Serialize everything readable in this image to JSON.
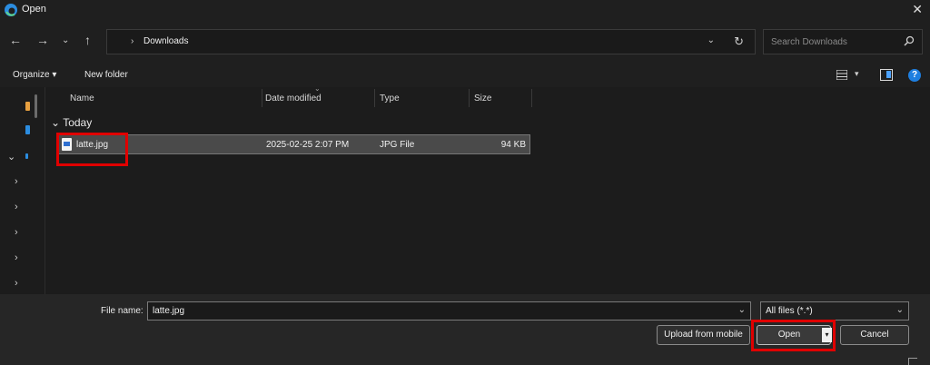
{
  "window": {
    "title": "Open"
  },
  "nav": {
    "back_icon": "arrow-left-icon",
    "forward_icon": "arrow-right-icon",
    "recent_icon": "chevron-down-icon",
    "up_icon": "arrow-up-icon"
  },
  "address": {
    "separator": "›",
    "location": "Downloads"
  },
  "search": {
    "placeholder": "Search Downloads"
  },
  "toolbar": {
    "organize_label": "Organize ▾",
    "new_folder_label": "New folder"
  },
  "columns": {
    "name": "Name",
    "date_modified": "Date modified",
    "type": "Type",
    "size": "Size"
  },
  "group": {
    "label": "Today"
  },
  "files": [
    {
      "name": "latte.jpg",
      "date_modified": "2025-02-25 2:07 PM",
      "type": "JPG File",
      "size": "94 KB"
    }
  ],
  "footer": {
    "file_name_label": "File name:",
    "file_name_value": "latte.jpg",
    "filter_value": "All files (*.*)",
    "upload_label": "Upload from mobile",
    "open_label": "Open",
    "cancel_label": "Cancel"
  },
  "colors": {
    "highlight": "#e00000",
    "accent": "#1e7fe0"
  }
}
